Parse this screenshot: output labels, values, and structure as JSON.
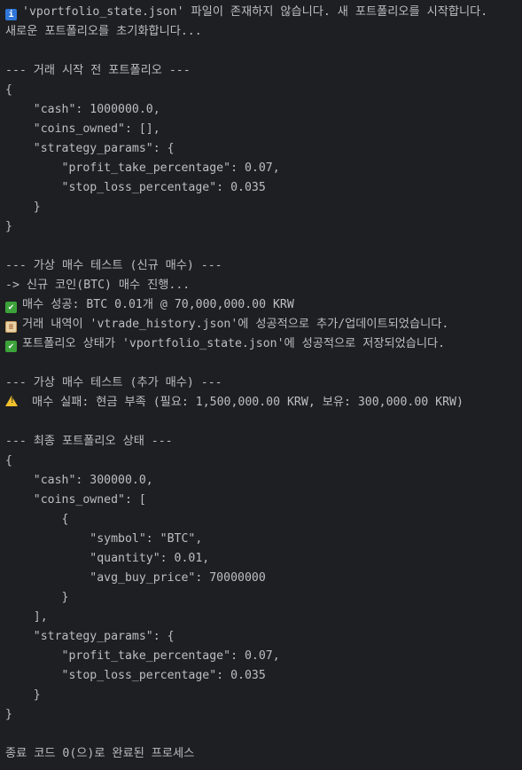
{
  "terminal": {
    "lines": [
      {
        "text": "'vportfolio_state.json' 파일이 존재하지 않습니다. 새 포트폴리오를 시작합니다.",
        "icon": "info-icon"
      },
      {
        "text": "새로운 포트폴리오를 초기화합니다..."
      },
      {
        "text": ""
      },
      {
        "text": "--- 거래 시작 전 포트폴리오 ---"
      },
      {
        "text": "{"
      },
      {
        "text": "    \"cash\": 1000000.0,"
      },
      {
        "text": "    \"coins_owned\": [],"
      },
      {
        "text": "    \"strategy_params\": {"
      },
      {
        "text": "        \"profit_take_percentage\": 0.07,"
      },
      {
        "text": "        \"stop_loss_percentage\": 0.035"
      },
      {
        "text": "    }"
      },
      {
        "text": "}"
      },
      {
        "text": ""
      },
      {
        "text": "--- 가상 매수 테스트 (신규 매수) ---"
      },
      {
        "text": "-> 신규 코인(BTC) 매수 진행..."
      },
      {
        "text": "매수 성공: BTC 0.01개 @ 70,000,000.00 KRW",
        "icon": "check-icon"
      },
      {
        "text": "거래 내역이 'vtrade_history.json'에 성공적으로 추가/업데이트되었습니다.",
        "icon": "scroll-icon"
      },
      {
        "text": "포트폴리오 상태가 'vportfolio_state.json'에 성공적으로 저장되었습니다.",
        "icon": "check-icon"
      },
      {
        "text": ""
      },
      {
        "text": "--- 가상 매수 테스트 (추가 매수) ---"
      },
      {
        "text": " 매수 실패: 현금 부족 (필요: 1,500,000.00 KRW, 보유: 300,000.00 KRW)",
        "icon": "warning-icon"
      },
      {
        "text": ""
      },
      {
        "text": "--- 최종 포트폴리오 상태 ---"
      },
      {
        "text": "{"
      },
      {
        "text": "    \"cash\": 300000.0,"
      },
      {
        "text": "    \"coins_owned\": ["
      },
      {
        "text": "        {"
      },
      {
        "text": "            \"symbol\": \"BTC\","
      },
      {
        "text": "            \"quantity\": 0.01,"
      },
      {
        "text": "            \"avg_buy_price\": 70000000"
      },
      {
        "text": "        }"
      },
      {
        "text": "    ],"
      },
      {
        "text": "    \"strategy_params\": {"
      },
      {
        "text": "        \"profit_take_percentage\": 0.07,"
      },
      {
        "text": "        \"stop_loss_percentage\": 0.035"
      },
      {
        "text": "    }"
      },
      {
        "text": "}"
      },
      {
        "text": ""
      },
      {
        "text": "종료 코드 0(으)로 완료된 프로세스"
      }
    ]
  },
  "colors": {
    "background": "#1e1f22",
    "text": "#bcbec4",
    "info": "#2f77d9",
    "success": "#3ca23a",
    "warning": "#f2c12e"
  }
}
